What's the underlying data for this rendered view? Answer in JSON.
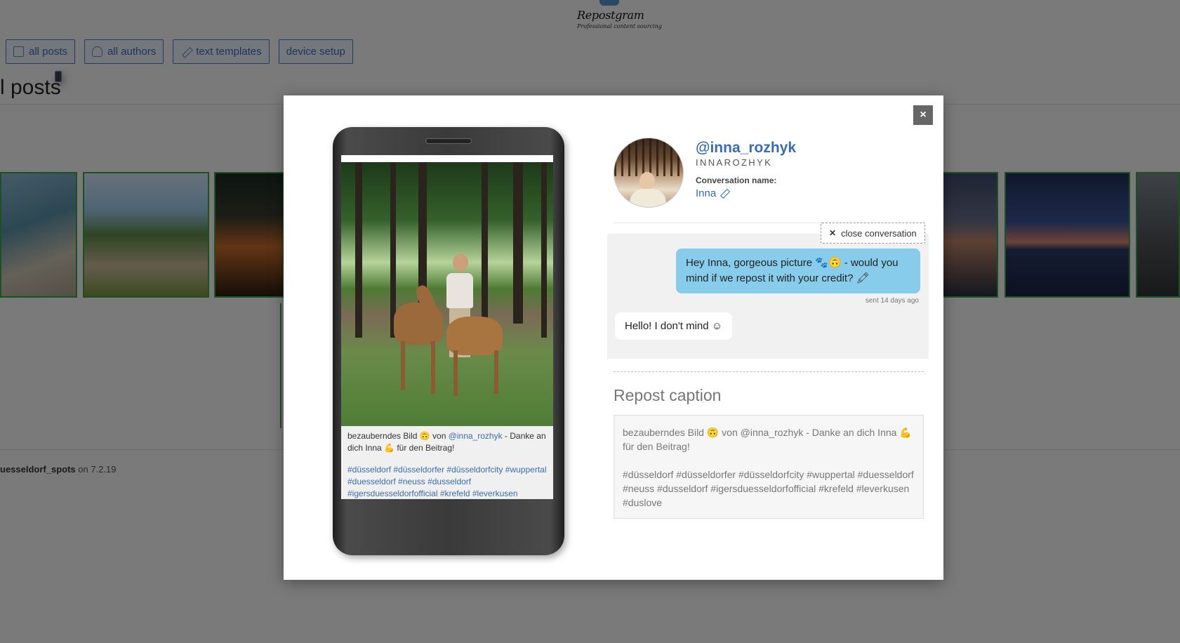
{
  "brand": {
    "name": "Repostgram",
    "tagline": "Professional content sourcing"
  },
  "nav": [
    {
      "label": "all posts",
      "icon": "posts-icon"
    },
    {
      "label": "all authors",
      "icon": "user-icon"
    },
    {
      "label": "text templates",
      "icon": "pencil-icon"
    },
    {
      "label": "device setup",
      "icon": "phone-icon"
    }
  ],
  "page": {
    "title": "l posts",
    "caption_author": "uesseldorf_spots",
    "caption_suffix": " on 7.2.19"
  },
  "modal": {
    "close_label": "×",
    "profile": {
      "username": "@inna_rozhyk",
      "fullname": "INNAROZHYK",
      "conversation_label": "Conversation name:",
      "conversation_name": "Inna"
    },
    "close_conversation_label": "close conversation",
    "messages": {
      "outgoing": "Hey Inna, gorgeous picture 🐾🙃 - would you mind if we repost it with your credit? 🖍",
      "outgoing_meta": "sent 14 days ago",
      "incoming": "Hello! I don't mind ☺"
    },
    "phone_post": {
      "text_before": "bezauberndes Bild 🙃 von ",
      "mention": "@inna_rozhyk",
      "text_after": " - Danke an dich Inna 💪 für den Beitrag!",
      "tags": "#düsseldorf #düsseldorfer #düsseldorfcity #wuppertal #duesseldorf #neuss #dusseldorf #igersduesseldorfofficial #krefeld #leverkusen"
    },
    "repost_caption": {
      "title": "Repost caption",
      "line1": "bezauberndes Bild 🙃 von @inna_rozhyk - Danke an dich Inna 💪 für den Beitrag!",
      "line2": "#düsseldorf #düsseldorfer #düsseldorfcity #wuppertal #duesseldorf #neuss #dusseldorf #igersduesseldorfofficial #krefeld #leverkusen #duslove"
    }
  },
  "colors": {
    "accent": "#3a6cb0",
    "bubble_out": "#87ccea",
    "thumb_border": "#3fa04a",
    "overlay": "rgba(0,0,0,0.5)"
  }
}
